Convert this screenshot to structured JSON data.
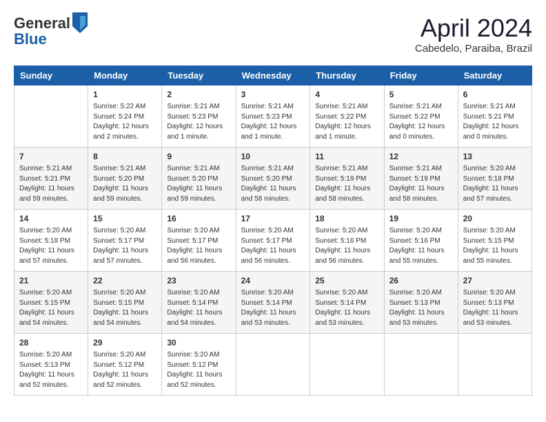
{
  "header": {
    "logo_line1": "General",
    "logo_line2": "Blue",
    "month": "April 2024",
    "location": "Cabedelo, Paraiba, Brazil"
  },
  "days_of_week": [
    "Sunday",
    "Monday",
    "Tuesday",
    "Wednesday",
    "Thursday",
    "Friday",
    "Saturday"
  ],
  "weeks": [
    [
      {
        "day": "",
        "info": ""
      },
      {
        "day": "1",
        "info": "Sunrise: 5:22 AM\nSunset: 5:24 PM\nDaylight: 12 hours\nand 2 minutes."
      },
      {
        "day": "2",
        "info": "Sunrise: 5:21 AM\nSunset: 5:23 PM\nDaylight: 12 hours\nand 1 minute."
      },
      {
        "day": "3",
        "info": "Sunrise: 5:21 AM\nSunset: 5:23 PM\nDaylight: 12 hours\nand 1 minute."
      },
      {
        "day": "4",
        "info": "Sunrise: 5:21 AM\nSunset: 5:22 PM\nDaylight: 12 hours\nand 1 minute."
      },
      {
        "day": "5",
        "info": "Sunrise: 5:21 AM\nSunset: 5:22 PM\nDaylight: 12 hours\nand 0 minutes."
      },
      {
        "day": "6",
        "info": "Sunrise: 5:21 AM\nSunset: 5:21 PM\nDaylight: 12 hours\nand 0 minutes."
      }
    ],
    [
      {
        "day": "7",
        "info": "Sunrise: 5:21 AM\nSunset: 5:21 PM\nDaylight: 11 hours\nand 59 minutes."
      },
      {
        "day": "8",
        "info": "Sunrise: 5:21 AM\nSunset: 5:20 PM\nDaylight: 11 hours\nand 59 minutes."
      },
      {
        "day": "9",
        "info": "Sunrise: 5:21 AM\nSunset: 5:20 PM\nDaylight: 11 hours\nand 59 minutes."
      },
      {
        "day": "10",
        "info": "Sunrise: 5:21 AM\nSunset: 5:20 PM\nDaylight: 11 hours\nand 58 minutes."
      },
      {
        "day": "11",
        "info": "Sunrise: 5:21 AM\nSunset: 5:19 PM\nDaylight: 11 hours\nand 58 minutes."
      },
      {
        "day": "12",
        "info": "Sunrise: 5:21 AM\nSunset: 5:19 PM\nDaylight: 11 hours\nand 58 minutes."
      },
      {
        "day": "13",
        "info": "Sunrise: 5:20 AM\nSunset: 5:18 PM\nDaylight: 11 hours\nand 57 minutes."
      }
    ],
    [
      {
        "day": "14",
        "info": "Sunrise: 5:20 AM\nSunset: 5:18 PM\nDaylight: 11 hours\nand 57 minutes."
      },
      {
        "day": "15",
        "info": "Sunrise: 5:20 AM\nSunset: 5:17 PM\nDaylight: 11 hours\nand 57 minutes."
      },
      {
        "day": "16",
        "info": "Sunrise: 5:20 AM\nSunset: 5:17 PM\nDaylight: 11 hours\nand 56 minutes."
      },
      {
        "day": "17",
        "info": "Sunrise: 5:20 AM\nSunset: 5:17 PM\nDaylight: 11 hours\nand 56 minutes."
      },
      {
        "day": "18",
        "info": "Sunrise: 5:20 AM\nSunset: 5:16 PM\nDaylight: 11 hours\nand 56 minutes."
      },
      {
        "day": "19",
        "info": "Sunrise: 5:20 AM\nSunset: 5:16 PM\nDaylight: 11 hours\nand 55 minutes."
      },
      {
        "day": "20",
        "info": "Sunrise: 5:20 AM\nSunset: 5:15 PM\nDaylight: 11 hours\nand 55 minutes."
      }
    ],
    [
      {
        "day": "21",
        "info": "Sunrise: 5:20 AM\nSunset: 5:15 PM\nDaylight: 11 hours\nand 54 minutes."
      },
      {
        "day": "22",
        "info": "Sunrise: 5:20 AM\nSunset: 5:15 PM\nDaylight: 11 hours\nand 54 minutes."
      },
      {
        "day": "23",
        "info": "Sunrise: 5:20 AM\nSunset: 5:14 PM\nDaylight: 11 hours\nand 54 minutes."
      },
      {
        "day": "24",
        "info": "Sunrise: 5:20 AM\nSunset: 5:14 PM\nDaylight: 11 hours\nand 53 minutes."
      },
      {
        "day": "25",
        "info": "Sunrise: 5:20 AM\nSunset: 5:14 PM\nDaylight: 11 hours\nand 53 minutes."
      },
      {
        "day": "26",
        "info": "Sunrise: 5:20 AM\nSunset: 5:13 PM\nDaylight: 11 hours\nand 53 minutes."
      },
      {
        "day": "27",
        "info": "Sunrise: 5:20 AM\nSunset: 5:13 PM\nDaylight: 11 hours\nand 53 minutes."
      }
    ],
    [
      {
        "day": "28",
        "info": "Sunrise: 5:20 AM\nSunset: 5:13 PM\nDaylight: 11 hours\nand 52 minutes."
      },
      {
        "day": "29",
        "info": "Sunrise: 5:20 AM\nSunset: 5:12 PM\nDaylight: 11 hours\nand 52 minutes."
      },
      {
        "day": "30",
        "info": "Sunrise: 5:20 AM\nSunset: 5:12 PM\nDaylight: 11 hours\nand 52 minutes."
      },
      {
        "day": "",
        "info": ""
      },
      {
        "day": "",
        "info": ""
      },
      {
        "day": "",
        "info": ""
      },
      {
        "day": "",
        "info": ""
      }
    ]
  ]
}
